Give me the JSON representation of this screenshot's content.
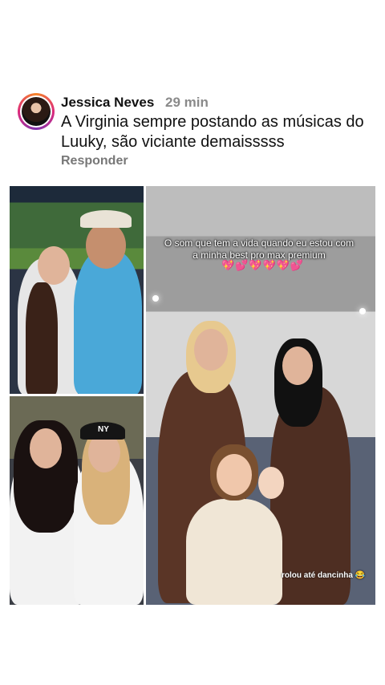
{
  "comment": {
    "username": "Jessica Neves",
    "time": "29 min",
    "text": "A Virginia sempre postando as músicas do Luuky, são viciante demaisssss",
    "reply_label": "Responder"
  },
  "media": {
    "caption_line1": "O som que tem a vida quando eu estou com",
    "caption_line2": "a minha best pro max premium",
    "hearts": "💖💕💖💖💖💕",
    "dance_caption": "rolou até dancinha 😂",
    "cap_logo": "NY"
  },
  "colors": {
    "avatar_ring": "#dd2a7b",
    "time": "#8a8a8a",
    "reply": "#777777"
  }
}
